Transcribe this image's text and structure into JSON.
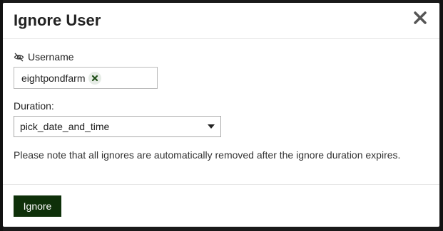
{
  "modal": {
    "title": "Ignore User",
    "close_icon": "close-icon"
  },
  "username": {
    "label": "Username",
    "label_icon": "eye-slash-icon",
    "chip_value": "eightpondfarm",
    "chip_remove_icon": "x-icon"
  },
  "duration": {
    "label": "Duration:",
    "selected": "pick_date_and_time",
    "caret_icon": "caret-down-icon"
  },
  "note": "Please note that all ignores are automatically removed after the ignore duration expires.",
  "footer": {
    "ignore_label": "Ignore"
  },
  "colors": {
    "primary_button": "#0e3009",
    "chip_bg": "#e6ece6",
    "chip_icon": "#1e4d16"
  }
}
